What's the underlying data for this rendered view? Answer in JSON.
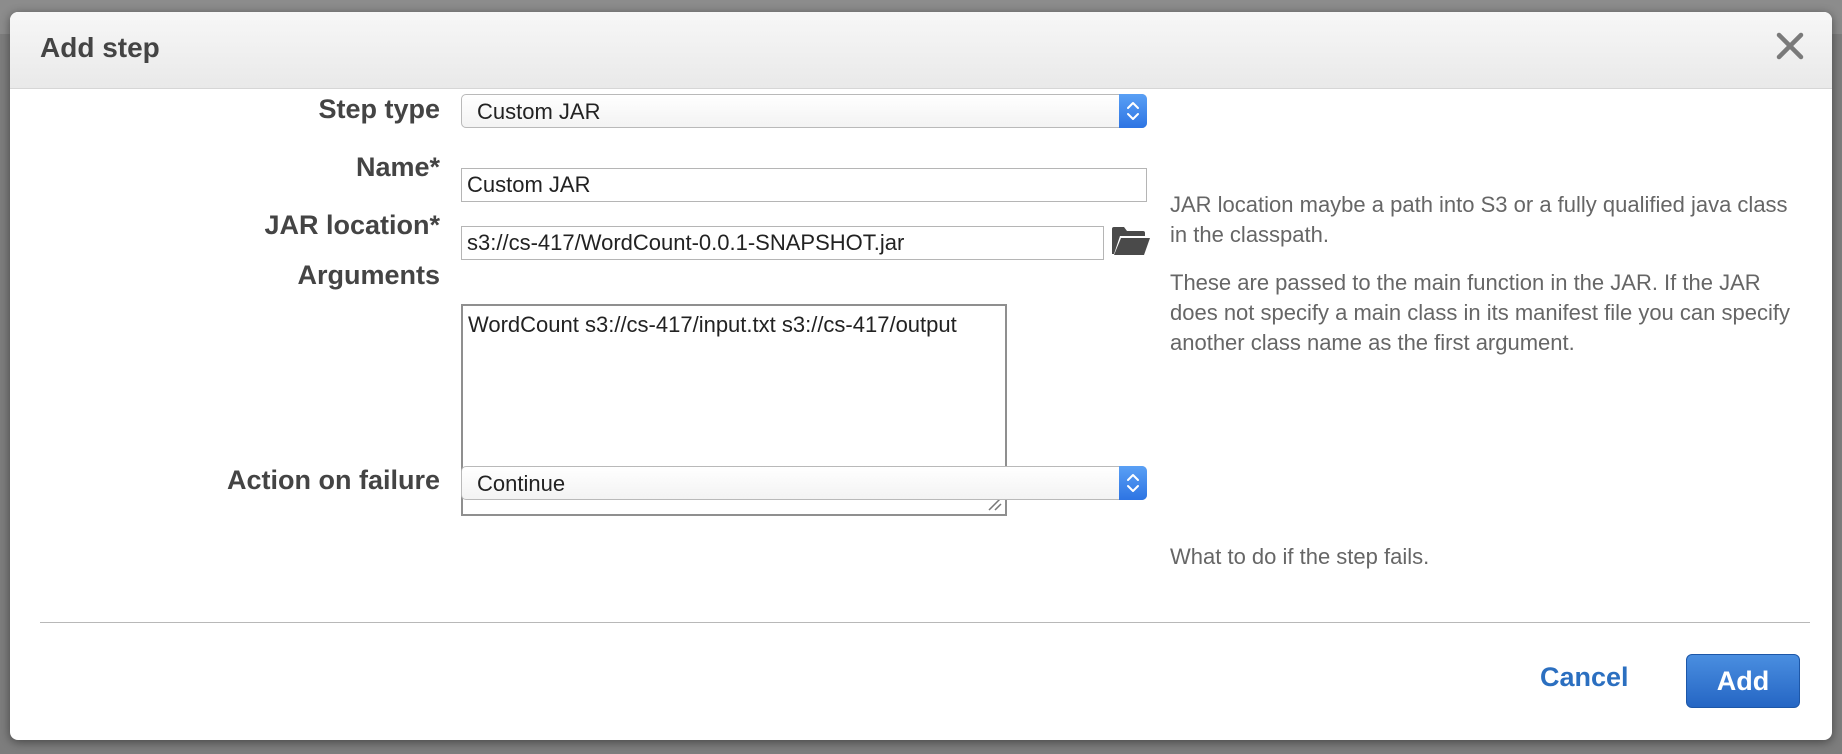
{
  "dialog": {
    "title": "Add step"
  },
  "form": {
    "step_type": {
      "label": "Step type",
      "value": "Custom JAR"
    },
    "name": {
      "label": "Name*",
      "value": "Custom JAR"
    },
    "jar_location": {
      "label": "JAR location*",
      "value": "s3://cs-417/WordCount-0.0.1-SNAPSHOT.jar",
      "help": "JAR location maybe a path into S3 or a fully qualified java class in the classpath."
    },
    "arguments": {
      "label": "Arguments",
      "value": "WordCount s3://cs-417/input.txt s3://cs-417/output",
      "help": "These are passed to the main function in the JAR. If the JAR does not specify a main class in its manifest file you can specify another class name as the first argument."
    },
    "action_on_failure": {
      "label": "Action on failure",
      "value": "Continue",
      "help": "What to do if the step fails."
    }
  },
  "footer": {
    "cancel_label": "Cancel",
    "add_label": "Add"
  },
  "icons": {
    "close": "close-icon",
    "folder": "folder-open-icon",
    "select_arrows": "chevron-up-down-icon"
  },
  "colors": {
    "accent": "#2b6fc0",
    "primary_button": "#2d74e3"
  }
}
